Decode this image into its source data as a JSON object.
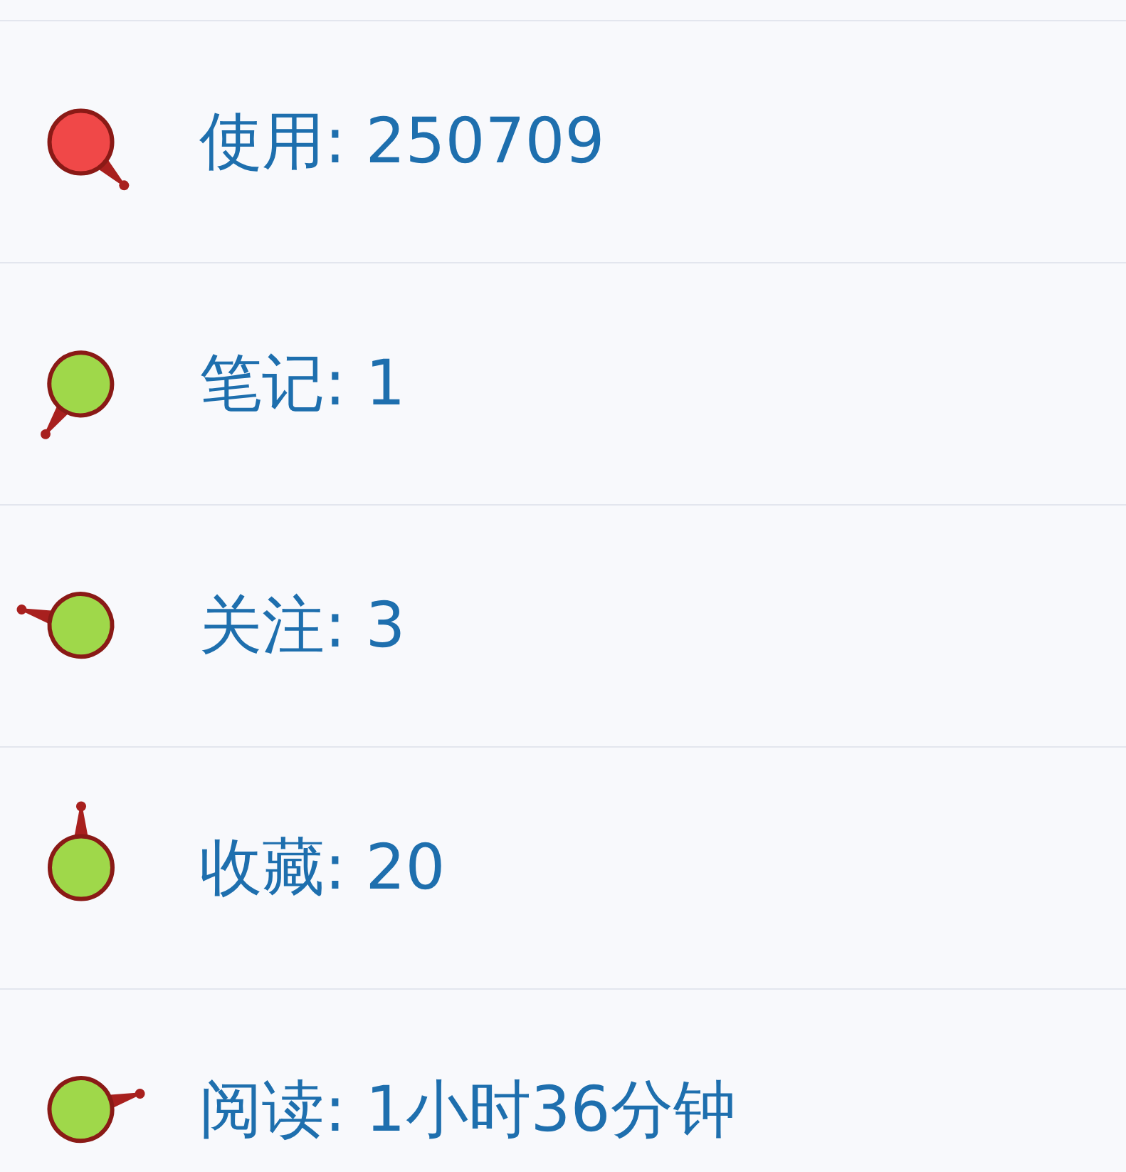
{
  "stats": [
    {
      "label": "使用: 250709",
      "color": "#f04848",
      "kind": "southeast"
    },
    {
      "label": "笔记: 1",
      "color": "#9fd84a",
      "kind": "southwest"
    },
    {
      "label": "关注: 3",
      "color": "#9fd84a",
      "kind": "west"
    },
    {
      "label": "收藏: 20",
      "color": "#9fd84a",
      "kind": "north"
    },
    {
      "label": "阅读: 1小时36分钟",
      "color": "#9fd84a",
      "kind": "east"
    }
  ]
}
